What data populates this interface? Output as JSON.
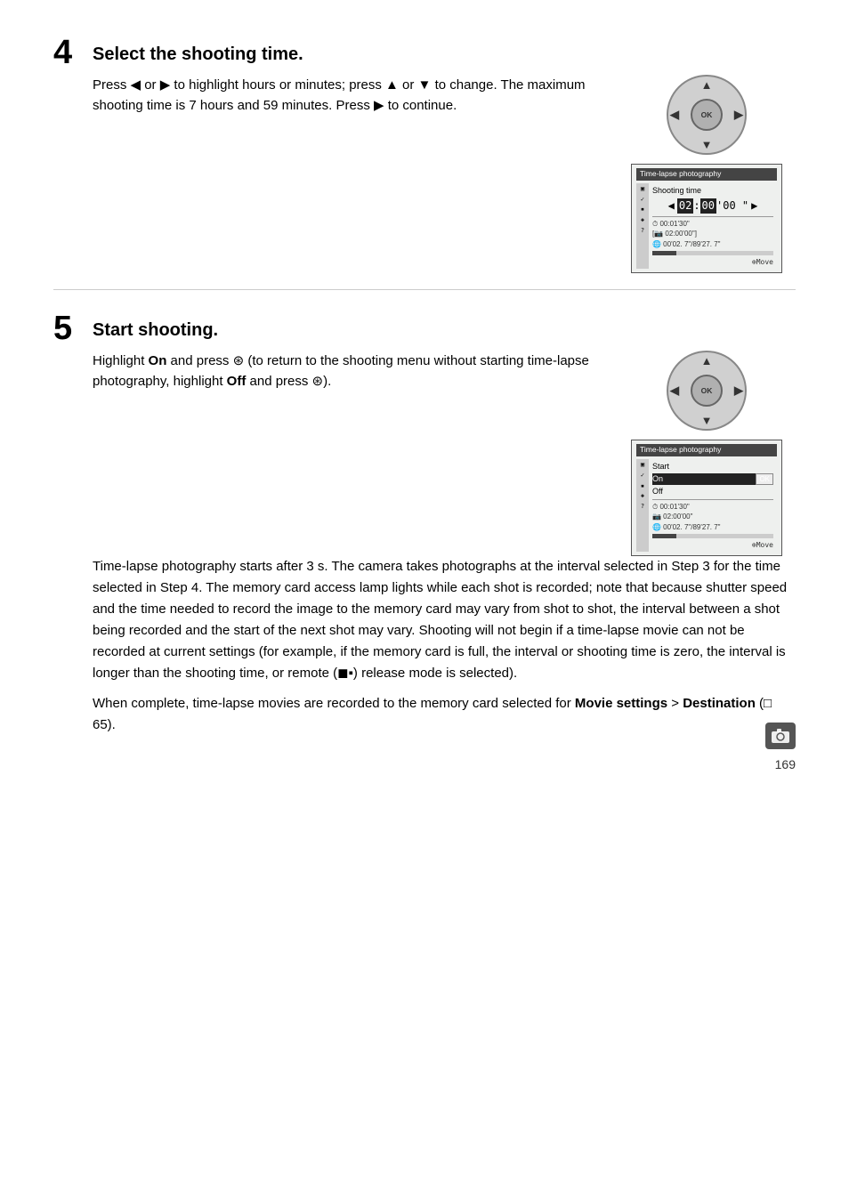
{
  "page": {
    "number": "169",
    "steps": [
      {
        "id": "step4",
        "number": "4",
        "title": "Select the shooting time.",
        "body_lines": [
          "Press ◀ or ▶ to highlight hours or minutes; press ▲ or ▼ to change.  The maximum shooting time is 7 hours and 59 minutes. Press ▶ to continue."
        ],
        "screen": {
          "title": "Time-lapse photography",
          "subtitle": "Shooting time",
          "time_display": "02 : 00 ' 00 \"",
          "stats": [
            "⏱ 00:01'30\"",
            "📷 02:00'00\"",
            "🌐 00'02. 7\"/89'27. 7\""
          ],
          "move_label": "⊕Move"
        }
      },
      {
        "id": "step5",
        "number": "5",
        "title": "Start shooting.",
        "body_highlight_lines": [
          "Highlight On and press ⊛ (to return to the shooting menu without starting time-lapse photography, highlight Off and press ⊛)."
        ],
        "body_para": "Time-lapse photography starts after 3 s.  The camera takes photographs at the interval selected in Step 3 for the time selected in Step 4.  The memory card access lamp lights while each shot is recorded; note that because shutter speed and the time needed to record the image to the memory card may vary from shot to shot, the interval between a shot being recorded and the start of the next shot may vary.  Shooting will not begin if a time-lapse movie can not be recorded at current settings (for example, if the memory card is full, the interval or shooting time is zero, the interval is longer than the shooting time, or remote (◼▪) release mode is selected).",
        "body_para2": "When complete, time-lapse movies are recorded to the memory card selected for Movie settings > Destination (□ 65).",
        "screen": {
          "title": "Time-lapse photography",
          "subtitle": "Start",
          "rows": [
            {
              "label": "On",
              "selected": true,
              "badge": "OK"
            },
            {
              "label": "Off",
              "selected": false
            }
          ],
          "stats": [
            "⏱ 00:01'30\"",
            "📷 02:00'00\"",
            "🌐 00'02. 7\"/89'27. 7\""
          ],
          "move_label": "⊕Move"
        }
      }
    ]
  }
}
